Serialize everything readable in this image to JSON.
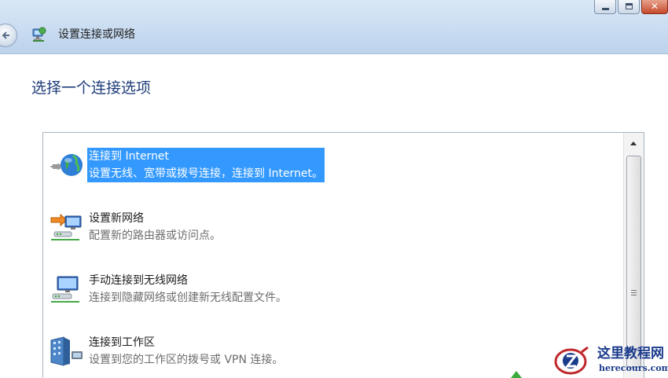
{
  "window": {
    "title": "设置连接或网络",
    "controls": [
      "minimize-icon",
      "maximize-icon",
      "close-icon"
    ],
    "close_glyph": "✕"
  },
  "instruction": "选择一个连接选项",
  "options": [
    {
      "name": "连接到 Internet",
      "description": "设置无线、宽带或拨号连接，连接到 Internet。",
      "icon": "globe-network-icon",
      "selected": true
    },
    {
      "name": "设置新网络",
      "description": "配置新的路由器或访问点。",
      "icon": "new-network-icon",
      "selected": false
    },
    {
      "name": "手动连接到无线网络",
      "description": "连接到隐藏网络或创建新无线配置文件。",
      "icon": "wireless-network-icon",
      "selected": false
    },
    {
      "name": "连接到工作区",
      "description": "设置到您的工作区的拨号或 VPN 连接。",
      "icon": "workplace-icon",
      "selected": false
    }
  ],
  "watermark": {
    "title": "这里教程网",
    "url": "herecours.com"
  },
  "colors": {
    "selection": "#3399ff",
    "instruction": "#1f3d7a",
    "header": "#c9dcf1"
  }
}
